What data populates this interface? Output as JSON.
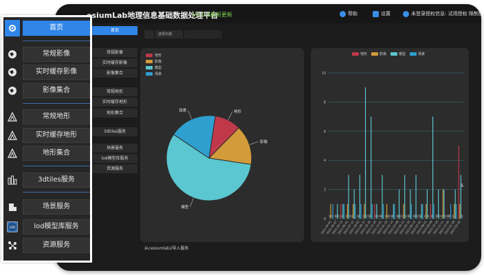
{
  "app": {
    "title": "esiumLab地理信息基础数据处理平台",
    "version": "V3.0.8最新更新",
    "help_label": "帮助",
    "settings_label": "设置",
    "user_label": "未登录授权信息: 试用授权 限制授权"
  },
  "sidebar": {
    "items": [
      {
        "label": "首页",
        "icon": "gear-icon",
        "active": true
      },
      {
        "label": "常规影像",
        "icon": "globe-icon"
      },
      {
        "label": "实时缓存影像",
        "icon": "globe-icon"
      },
      {
        "label": "影像集合",
        "icon": "globe-icon"
      },
      {
        "label": "常规地形",
        "icon": "terrain-icon"
      },
      {
        "label": "实时缓存地形",
        "icon": "terrain-icon"
      },
      {
        "label": "地形集合",
        "icon": "terrain-icon"
      },
      {
        "label": "3dtiles服务",
        "icon": "buildings-icon"
      },
      {
        "label": "场景服务",
        "icon": "building-icon"
      },
      {
        "label": "lod模型库服务",
        "icon": "lod-icon"
      },
      {
        "label": "资源服务",
        "icon": "network-icon"
      }
    ]
  },
  "inner_sidebar": {
    "items": [
      "首页",
      "常规影像",
      "实时缓存影像",
      "影像集合",
      "常规地形",
      "实时缓存地形",
      "地形集合",
      "3dtiles服务",
      "场景服务",
      "lod模型库服务",
      "资源服务"
    ]
  },
  "search": {
    "placeholder": "选择日期"
  },
  "footer": {
    "text": "从cesiumlab2导入服务"
  },
  "colors": {
    "terrain": "#c0394b",
    "imagery": "#d39c3a",
    "model": "#5bc7d0",
    "scene": "#2f9fd0"
  },
  "chart_data": [
    {
      "type": "pie",
      "legend": [
        "地形",
        "影像",
        "模型",
        "场景"
      ],
      "slice_labels": [
        "地形",
        "影像",
        "模型",
        "场景"
      ],
      "values": [
        10,
        15,
        57,
        18
      ]
    },
    {
      "type": "bar",
      "legend": [
        "地形",
        "影像",
        "模型",
        "场景"
      ],
      "ylim": [
        0,
        10
      ],
      "yticks": [
        0,
        2,
        4,
        6,
        8,
        10
      ],
      "categories": [
        "2021-04-01",
        "2021-04-07",
        "2021-05-13",
        "2021-06-01",
        "2021-07-12",
        "2021-08-02",
        "2021-09-15",
        "2021-10-20",
        "2021-11-03",
        "2021-12-01",
        "2022-01-10",
        "2022-02-14",
        "2022-03-08",
        "2022-04-12",
        "2022-05-20",
        "2022-06-15",
        "2022-07-01",
        "2022-08-22",
        "2022-09-09",
        "2022-10-18",
        "2022-11-11",
        "2022-12-05",
        "2023-01-09",
        "2023-02-26"
      ],
      "series": [
        {
          "name": "地形",
          "values": [
            0,
            0,
            1,
            0,
            0,
            0,
            0,
            0,
            1,
            0,
            0,
            0,
            0,
            0,
            0,
            0,
            0,
            0,
            1,
            0,
            0,
            0,
            0,
            5
          ]
        },
        {
          "name": "影像",
          "values": [
            1,
            0,
            0,
            1,
            1,
            0,
            1,
            0,
            0,
            0,
            1,
            0,
            0,
            1,
            0,
            0,
            0,
            1,
            0,
            0,
            2,
            0,
            1,
            1
          ]
        },
        {
          "name": "模型",
          "values": [
            0,
            1,
            1,
            3,
            2,
            3,
            9,
            7,
            1,
            3,
            0,
            1,
            2,
            3,
            2,
            3,
            1,
            2,
            7,
            2,
            2,
            0,
            2,
            3
          ]
        },
        {
          "name": "场景",
          "values": [
            1,
            0,
            1,
            0,
            1,
            1,
            0,
            1,
            0,
            1,
            0,
            1,
            0,
            0,
            1,
            0,
            1,
            0,
            1,
            0,
            0,
            1,
            1,
            0
          ]
        }
      ],
      "data_labels": [
        {
          "series": 0,
          "index": 23,
          "text": "5"
        }
      ]
    }
  ]
}
